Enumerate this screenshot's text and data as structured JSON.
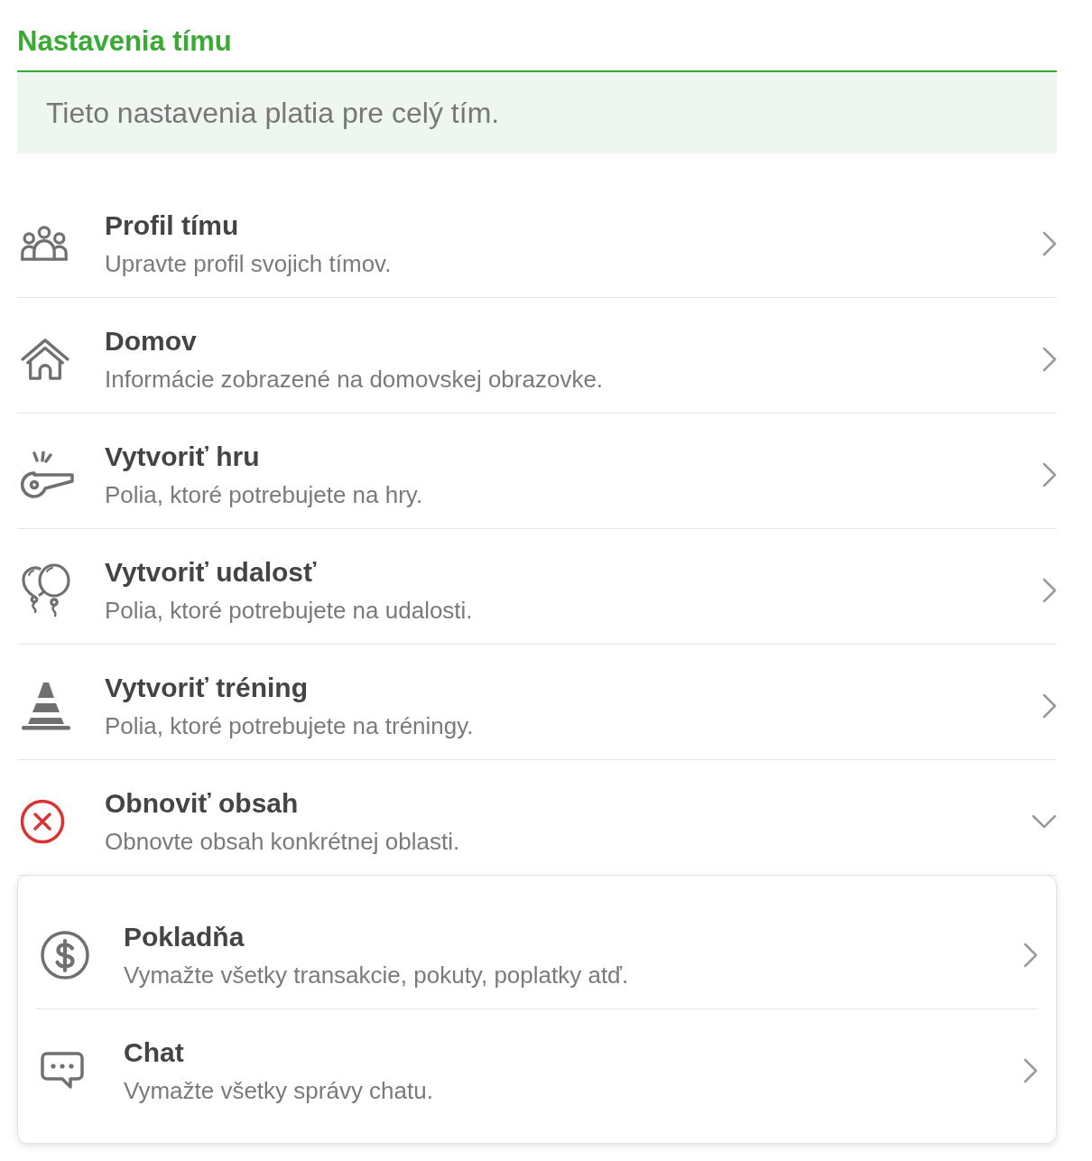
{
  "page": {
    "title": "Nastavenia tímu"
  },
  "notice": {
    "text": "Tieto nastavenia platia pre celý tím."
  },
  "items": [
    {
      "title": "Profil tímu",
      "subtitle": "Upravte profil svojich tímov."
    },
    {
      "title": "Domov",
      "subtitle": "Informácie zobrazené na domovskej obrazovke."
    },
    {
      "title": "Vytvoriť hru",
      "subtitle": "Polia, ktoré potrebujete na hry."
    },
    {
      "title": "Vytvoriť udalosť",
      "subtitle": "Polia, ktoré potrebujete na udalosti."
    },
    {
      "title": "Vytvoriť tréning",
      "subtitle": "Polia, ktoré potrebujete na tréningy."
    },
    {
      "title": "Obnoviť obsah",
      "subtitle": "Obnovte obsah konkrétnej oblasti.",
      "expanded": true,
      "children": [
        {
          "title": "Pokladňa",
          "subtitle": "Vymažte všetky transakcie, pokuty, poplatky atď."
        },
        {
          "title": "Chat",
          "subtitle": "Vymažte všetky správy chatu."
        }
      ]
    }
  ]
}
